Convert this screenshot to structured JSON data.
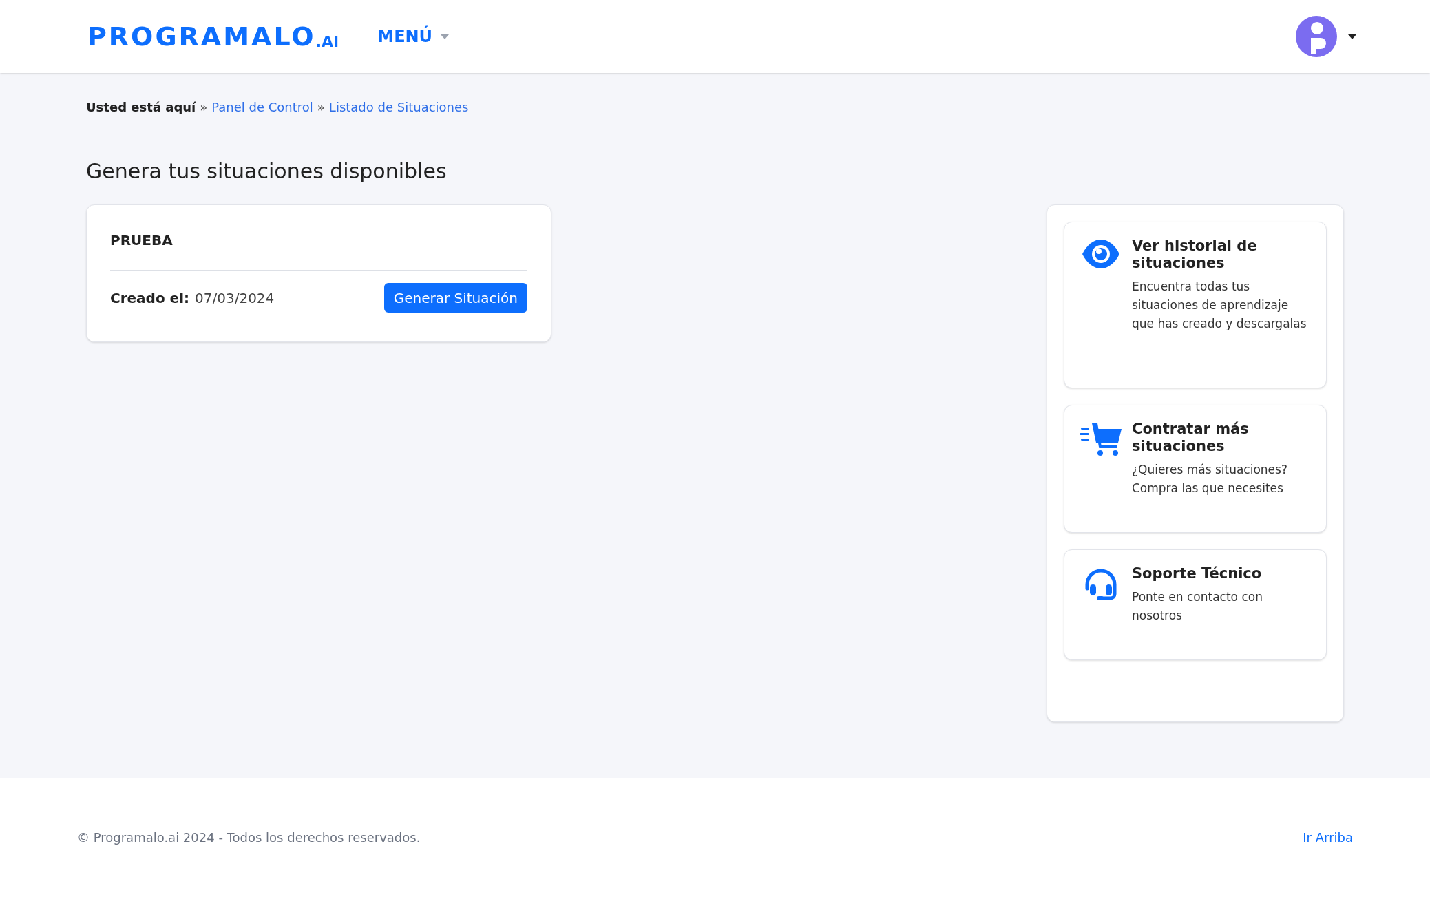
{
  "header": {
    "logo": {
      "name": "PROGRAMALO",
      "suffix": ".AI"
    },
    "menu": {
      "label": "MENÚ"
    }
  },
  "breadcrumb": {
    "label": "Usted está aquí",
    "items": [
      {
        "separator": "»",
        "text": "Panel de Control"
      },
      {
        "separator": "»",
        "text": "Listado de Situaciones"
      }
    ]
  },
  "heading": "Genera tus situaciones disponibles",
  "situations": [
    {
      "title": "PRUEBA",
      "created_label": "Creado el:",
      "created_date": "07/03/2024",
      "button": "Generar Situación"
    }
  ],
  "actions": [
    {
      "kind": "history",
      "title": "Ver historial de situaciones",
      "description": "Encuentra todas tus situaciones de aprendizaje que has creado y descargalas"
    },
    {
      "kind": "cart",
      "title": "Contratar más situaciones",
      "description": "¿Quieres más situaciones? Compra las que necesites"
    },
    {
      "kind": "support",
      "title": "Soporte Técnico",
      "description": "Ponte en contacto con nosotros"
    }
  ],
  "footer": {
    "copyright": "© Programalo.ai 2024 - Todos los derechos reservados.",
    "top_link": "Ir Arriba"
  }
}
